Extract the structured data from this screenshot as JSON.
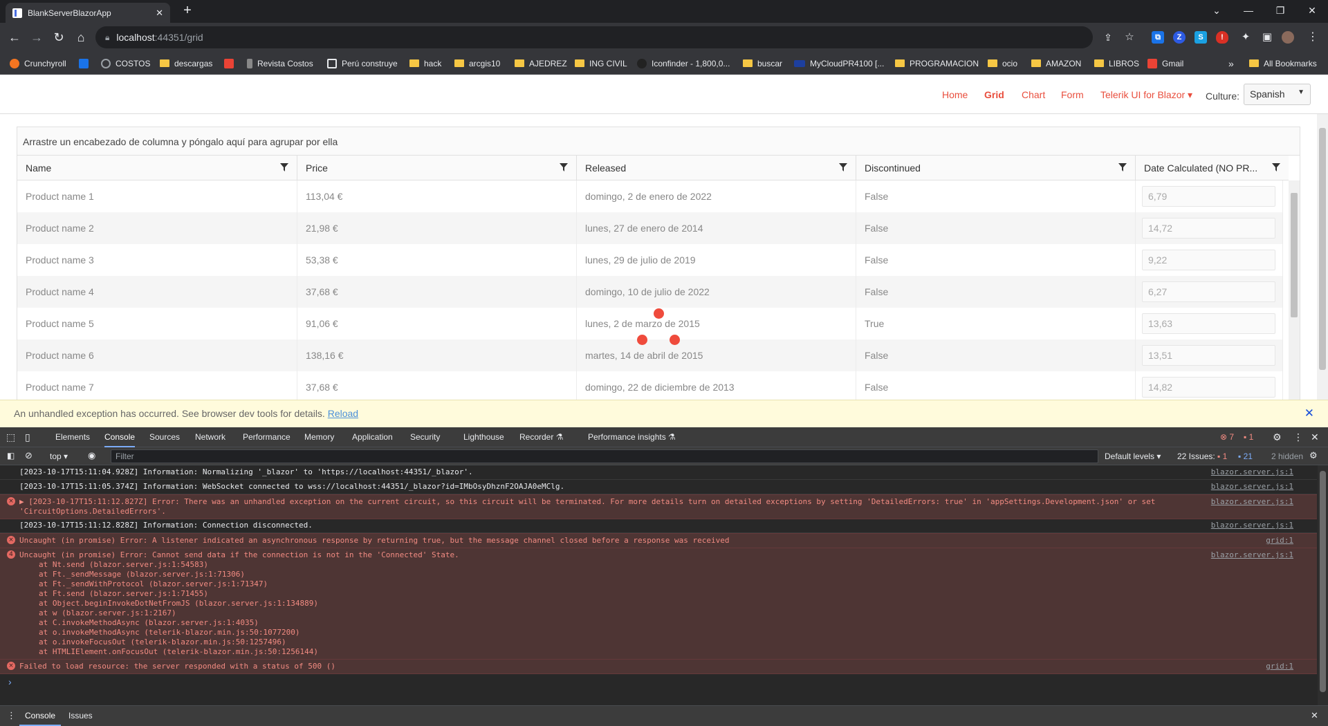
{
  "browser": {
    "tab_title": "BlankServerBlazorApp",
    "tab_close": "✕",
    "new_tab": "+",
    "window_controls": [
      "⌄",
      "—",
      "❐",
      "✕"
    ],
    "url_host": "localhost",
    "url_rest": ":44351/grid"
  },
  "bookmarks": [
    {
      "label": "Crunchyroll",
      "icon": "crunchyroll-icon"
    },
    {
      "label": "",
      "icon": "extension-icon"
    },
    {
      "label": "COSTOS",
      "icon": "globe-icon"
    },
    {
      "label": "descargas",
      "icon": "folder-icon"
    },
    {
      "label": "",
      "icon": "gmail-icon"
    },
    {
      "label": "Revista Costos",
      "icon": "revista-icon"
    },
    {
      "label": "Perú construye",
      "icon": "peru-construye-icon"
    },
    {
      "label": "hack",
      "icon": "folder-icon"
    },
    {
      "label": "arcgis10",
      "icon": "folder-icon"
    },
    {
      "label": "AJEDREZ",
      "icon": "folder-icon"
    },
    {
      "label": "ING CIVIL",
      "icon": "folder-icon"
    },
    {
      "label": "Iconfinder - 1,800,0...",
      "icon": "iconfinder-icon"
    },
    {
      "label": "buscar",
      "icon": "folder-icon"
    },
    {
      "label": "MyCloudPR4100 [...",
      "icon": "wd-icon"
    },
    {
      "label": "PROGRAMACION",
      "icon": "folder-icon"
    },
    {
      "label": "ocio",
      "icon": "folder-icon"
    },
    {
      "label": "AMAZON",
      "icon": "folder-icon"
    },
    {
      "label": "LIBROS",
      "icon": "folder-icon"
    },
    {
      "label": "Gmail",
      "icon": "gmail-icon"
    }
  ],
  "bookmarks_more": "»",
  "all_bookmarks": "All Bookmarks",
  "app_nav": {
    "links": [
      "Home",
      "Grid",
      "Chart",
      "Form",
      "Telerik UI for Blazor ▾"
    ],
    "active": "Grid",
    "culture_label": "Culture:",
    "culture_value": "Spanish",
    "accent_color": "#e94e3d"
  },
  "grid": {
    "group_hint": "Arrastre un encabezado de columna y póngalo aquí para agrupar por ella",
    "columns": [
      "Name",
      "Price",
      "Released",
      "Discontinued",
      "Date Calculated (NO PR..."
    ],
    "rows": [
      [
        "Product name 1",
        "113,04 €",
        "domingo, 2 de enero de 2022",
        "False",
        "6,79"
      ],
      [
        "Product name 2",
        "21,98 €",
        "lunes, 27 de enero de 2014",
        "False",
        "14,72"
      ],
      [
        "Product name 3",
        "53,38 €",
        "lunes, 29 de julio de 2019",
        "False",
        "9,22"
      ],
      [
        "Product name 4",
        "37,68 €",
        "domingo, 10 de julio de 2022",
        "False",
        "6,27"
      ],
      [
        "Product name 5",
        "91,06 €",
        "lunes, 2 de marzo de 2015",
        "True",
        "13,63"
      ],
      [
        "Product name 6",
        "138,16 €",
        "martes, 14 de abril de 2015",
        "False",
        "13,51"
      ],
      [
        "Product name 7",
        "37,68 €",
        "domingo, 22 de diciembre de 2013",
        "False",
        "14,82"
      ]
    ]
  },
  "error_bar": {
    "text": "An unhandled exception has occurred. See browser dev tools for details.",
    "link": "Reload",
    "close": "✕"
  },
  "devtools": {
    "tabs": [
      "Elements",
      "Console",
      "Sources",
      "Network",
      "Performance",
      "Memory",
      "Application",
      "Security",
      "Lighthouse",
      "Recorder ⚗",
      "Performance insights ⚗"
    ],
    "active_tab": "Console",
    "error_count": "7",
    "warning_count": "1",
    "context": "top ▾",
    "filter_placeholder": "Filter",
    "levels": "Default levels ▾",
    "issues_label": "22 Issues:",
    "issues_errors": "1",
    "issues_info": "21",
    "hidden": "2 hidden",
    "bottom_tabs": [
      "Console",
      "Issues"
    ],
    "messages": [
      {
        "type": "info",
        "text": "[2023-10-17T15:11:04.928Z] Information: Normalizing '_blazor' to 'https://localhost:44351/_blazor'.",
        "source": "blazor.server.js:1"
      },
      {
        "type": "info",
        "text": "[2023-10-17T15:11:05.374Z] Information: WebSocket connected to wss://localhost:44351/_blazor?id=IMbOsyDhznF2OAJA0eMClg.",
        "source": "blazor.server.js:1"
      },
      {
        "type": "error",
        "text": "▶ [2023-10-17T15:11:12.827Z] Error: There was an unhandled exception on the current circuit, so this circuit will be terminated. For more details turn on detailed exceptions by setting 'DetailedErrors: true' in 'appSettings.Development.json' or set 'CircuitOptions.DetailedErrors'.",
        "source": "blazor.server.js:1"
      },
      {
        "type": "info",
        "text": "[2023-10-17T15:11:12.828Z] Information: Connection disconnected.",
        "source": "blazor.server.js:1"
      },
      {
        "type": "error",
        "text": "Uncaught (in promise) Error: A listener indicated an asynchronous response by returning true, but the message channel closed before a response was received",
        "source": "grid:1"
      },
      {
        "type": "error",
        "count": "4",
        "text": "Uncaught (in promise) Error: Cannot send data if the connection is not in the 'Connected' State.",
        "source": "blazor.server.js:1",
        "stack": [
          "at Nt.send (blazor.server.js:1:54583)",
          "at Ft._sendMessage (blazor.server.js:1:71306)",
          "at Ft._sendWithProtocol (blazor.server.js:1:71347)",
          "at Ft.send (blazor.server.js:1:71455)",
          "at Object.beginInvokeDotNetFromJS (blazor.server.js:1:134889)",
          "at w (blazor.server.js:1:2167)",
          "at C.invokeMethodAsync (blazor.server.js:1:4035)",
          "at o.invokeMethodAsync (telerik-blazor.min.js:50:1077200)",
          "at o.invokeFocusOut (telerik-blazor.min.js:50:1257496)",
          "at HTMLIElement.onFocusOut (telerik-blazor.min.js:50:1256144)"
        ]
      },
      {
        "type": "error",
        "text": "Failed to load resource: the server responded with a status of 500 ()",
        "source": "grid:1"
      }
    ],
    "prompt": "›"
  }
}
